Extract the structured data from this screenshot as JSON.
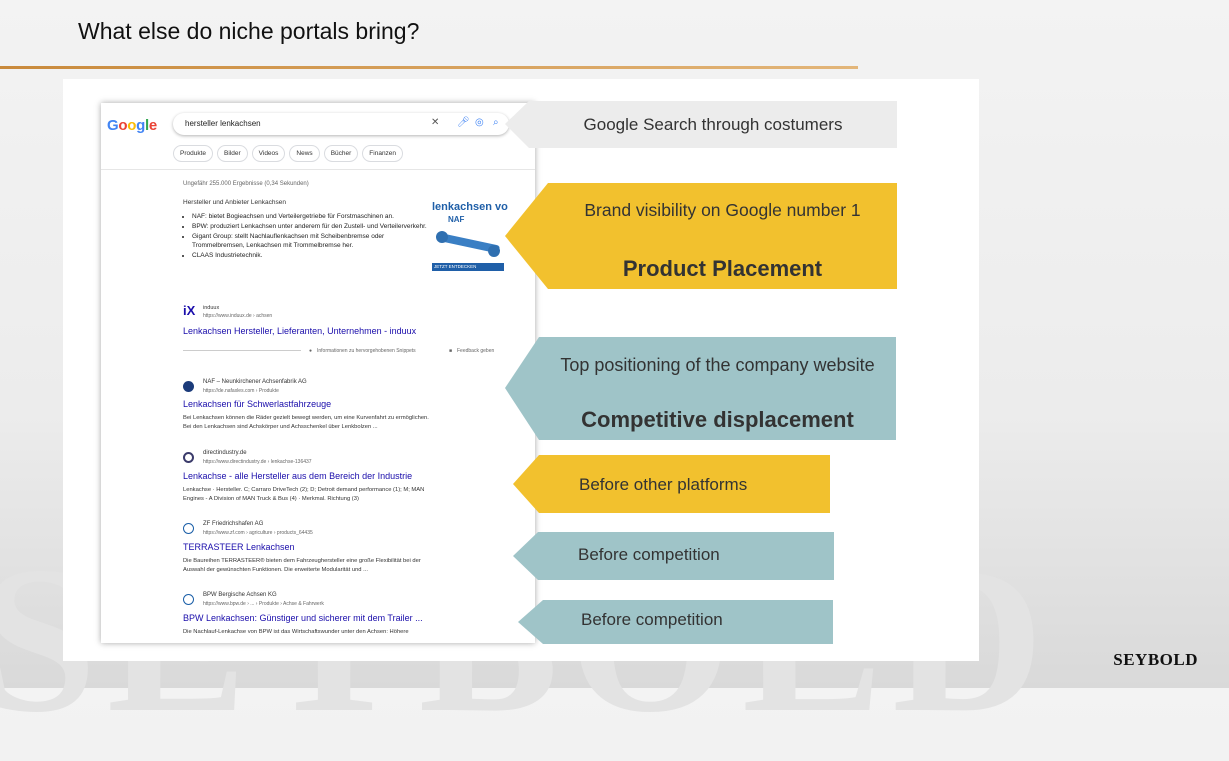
{
  "slide": {
    "title": "What else do niche portals bring?",
    "brand": "SEYBOLD",
    "background_word": "SEYBOLD",
    "colors": {
      "accent_rule": "#c98a3c",
      "gray_callout": "#ececec",
      "yellow_callout": "#f2c12e",
      "teal_callout": "#9fc4c8"
    }
  },
  "google": {
    "logo": [
      "G",
      "o",
      "o",
      "g",
      "l",
      "e"
    ],
    "query": "hersteller lenkachsen",
    "icons": [
      "close-icon",
      "mic-icon",
      "lens-icon",
      "search-icon"
    ],
    "chips": [
      "Produkte",
      "Bilder",
      "Videos",
      "News",
      "Bücher",
      "Finanzen"
    ],
    "result_count": "Ungefähr 255.000 Ergebnisse (0,34 Sekunden)",
    "snippet": {
      "heading": "Hersteller und Anbieter Lenkachsen",
      "bullets": [
        "NAF: bietet Bogieachsen und Verteilergetriebe für Forstmaschinen an.",
        "BPW: produziert Lenkachsen unter anderem für den Zustell- und Verteilerverkehr.",
        "Gigant Group: stellt Nachlauflenkachsen mit Scheibenbremse oder Trommelbremsen, Lenkachsen mit Trommelbremse her.",
        "CLAAS Industrietechnik."
      ],
      "image_title": "lenkachsen vo",
      "image_logo": "NAF",
      "image_footer": "JETZT ENTDECKEN"
    },
    "featured": {
      "logo": "iX",
      "site": "induux",
      "url": "https://www.induux.de › achsen",
      "title": "Lenkachsen Hersteller, Lieferanten, Unternehmen - induux",
      "info": "Informationen zu hervorgehobenen Snippets",
      "feedback": "Feedback geben"
    },
    "results": [
      {
        "site": "NAF – Neunkirchener Achsenfabrik AG",
        "url": "https://de.nafaxles.com › Produkte",
        "title": "Lenkachsen für Schwerlastfahrzeuge",
        "desc1": "Bei Lenkachsen können die Räder gezielt bewegt werden, um eine Kurvenfahrt zu ermöglichen.",
        "desc2": "Bei den Lenkachsen sind Achskörper und Achsschenkel über Lenkbolzen ..."
      },
      {
        "site": "directindustry.de",
        "url": "https://www.directindustry.de › lenkachse-136437",
        "title": "Lenkachse - alle Hersteller aus dem Bereich der Industrie",
        "desc1": "Lenkachse · Hersteller. C; Carraro DriveTech (2); D; Detroit demand performance (1); M; MAN",
        "desc2": "Engines - A Division of MAN Truck & Bus (4) · Merkmal. Richtung (3)"
      },
      {
        "site": "ZF Friedrichshafen AG",
        "url": "https://www.zf.com › agriculture › products_64435",
        "title": "TERRASTEER Lenkachsen",
        "desc1": "Die Baureihen TERRASTEER® bieten dem Fahrzeughersteller eine große Flexibilität bei der",
        "desc2": "Auswahl der gewünschten Funktionen. Die erweiterte Modularität und ..."
      },
      {
        "site": "BPW Bergische Achsen KG",
        "url": "https://www.bpw.de › ... › Produkte › Achse & Fahrwerk",
        "title": "BPW Lenkachsen: Günstiger und sicherer mit dem Trailer ...",
        "desc1": "Die Nachlauf-Lenkachse von BPW ist das Wirtschaftswunder unter den Achsen: Höhere",
        "desc2": ""
      }
    ]
  },
  "callouts": {
    "search": "Google Search through costumers",
    "brand_line": "Brand visibility on Google number 1",
    "brand_bold": "Product Placement",
    "top_line": "Top positioning of the company website",
    "top_bold": "Competitive displacement",
    "platforms": "Before other platforms",
    "competition1": "Before competition",
    "competition2": "Before competition"
  }
}
